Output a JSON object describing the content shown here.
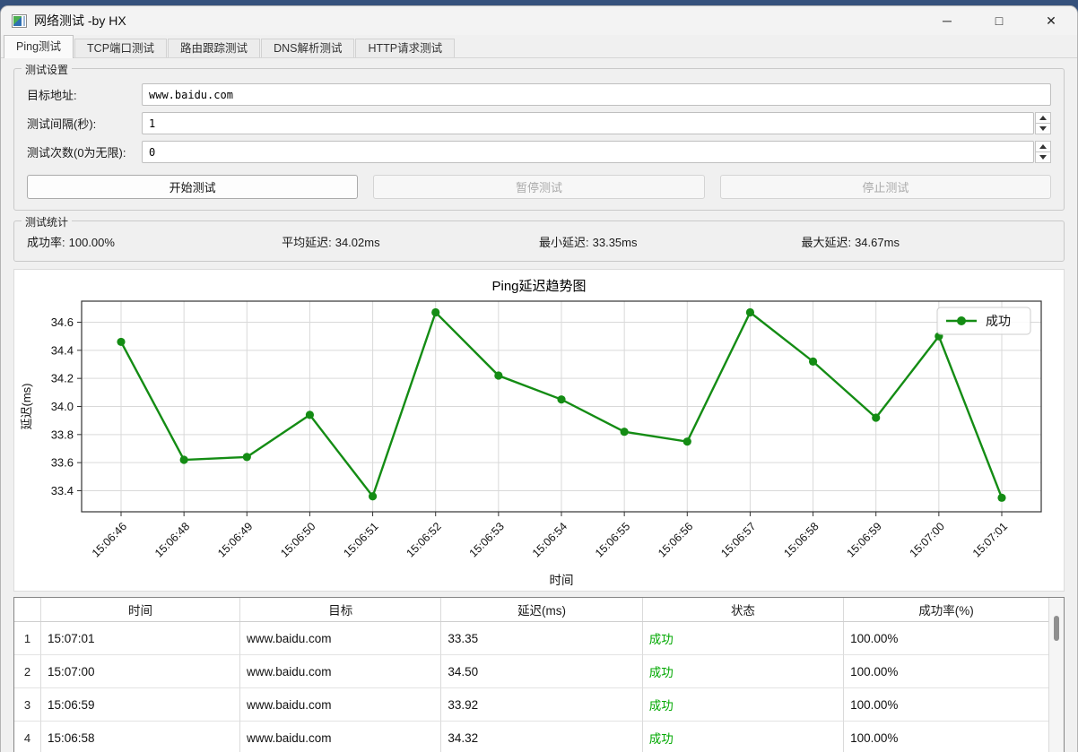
{
  "window": {
    "title": "网络测试 -by HX",
    "controls": {
      "minimize": "─",
      "maximize": "□",
      "close": "✕"
    }
  },
  "tabs": [
    {
      "label": "Ping测试",
      "selected": true
    },
    {
      "label": "TCP端口测试",
      "selected": false
    },
    {
      "label": "路由跟踪测试",
      "selected": false
    },
    {
      "label": "DNS解析测试",
      "selected": false
    },
    {
      "label": "HTTP请求测试",
      "selected": false
    }
  ],
  "settings": {
    "group_label": "测试设置",
    "fields": [
      {
        "label": "目标地址:",
        "value": "www.baidu.com",
        "spinner": false
      },
      {
        "label": "测试间隔(秒):",
        "value": "1",
        "spinner": true
      },
      {
        "label": "测试次数(0为无限):",
        "value": "0",
        "spinner": true
      }
    ],
    "buttons": [
      {
        "label": "开始测试",
        "enabled": true
      },
      {
        "label": "暂停测试",
        "enabled": false
      },
      {
        "label": "停止测试",
        "enabled": false
      }
    ]
  },
  "stats": {
    "group_label": "测试统计",
    "items": [
      {
        "label": "成功率:",
        "value": "100.00%"
      },
      {
        "label": "平均延迟:",
        "value": "34.02ms"
      },
      {
        "label": "最小延迟:",
        "value": "33.35ms"
      },
      {
        "label": "最大延迟:",
        "value": "34.67ms"
      }
    ]
  },
  "chart_data": {
    "type": "line",
    "title": "Ping延迟趋势图",
    "xlabel": "时间",
    "ylabel": "延迟(ms)",
    "grid": true,
    "legend_position": "top-right",
    "x": [
      "15:06:46",
      "15:06:48",
      "15:06:49",
      "15:06:50",
      "15:06:51",
      "15:06:52",
      "15:06:53",
      "15:06:54",
      "15:06:55",
      "15:06:56",
      "15:06:57",
      "15:06:58",
      "15:06:59",
      "15:07:00",
      "15:07:01"
    ],
    "series": [
      {
        "name": "成功",
        "color": "#148c14",
        "values": [
          34.46,
          33.62,
          33.64,
          33.94,
          33.36,
          34.67,
          34.22,
          34.05,
          33.82,
          33.75,
          34.67,
          34.32,
          33.92,
          34.5,
          33.35
        ]
      }
    ],
    "yticks": [
      33.4,
      33.6,
      33.8,
      34.0,
      34.2,
      34.4,
      34.6
    ],
    "ylim": [
      33.25,
      34.75
    ]
  },
  "table": {
    "columns": [
      "时间",
      "目标",
      "延迟(ms)",
      "状态",
      "成功率(%)"
    ],
    "status_color": "#00a800",
    "rows": [
      {
        "index": "1",
        "time": "15:07:01",
        "target": "www.baidu.com",
        "latency": "33.35",
        "status": "成功",
        "success_rate": "100.00%"
      },
      {
        "index": "2",
        "time": "15:07:00",
        "target": "www.baidu.com",
        "latency": "34.50",
        "status": "成功",
        "success_rate": "100.00%"
      },
      {
        "index": "3",
        "time": "15:06:59",
        "target": "www.baidu.com",
        "latency": "33.92",
        "status": "成功",
        "success_rate": "100.00%"
      },
      {
        "index": "4",
        "time": "15:06:58",
        "target": "www.baidu.com",
        "latency": "34.32",
        "status": "成功",
        "success_rate": "100.00%"
      }
    ]
  }
}
